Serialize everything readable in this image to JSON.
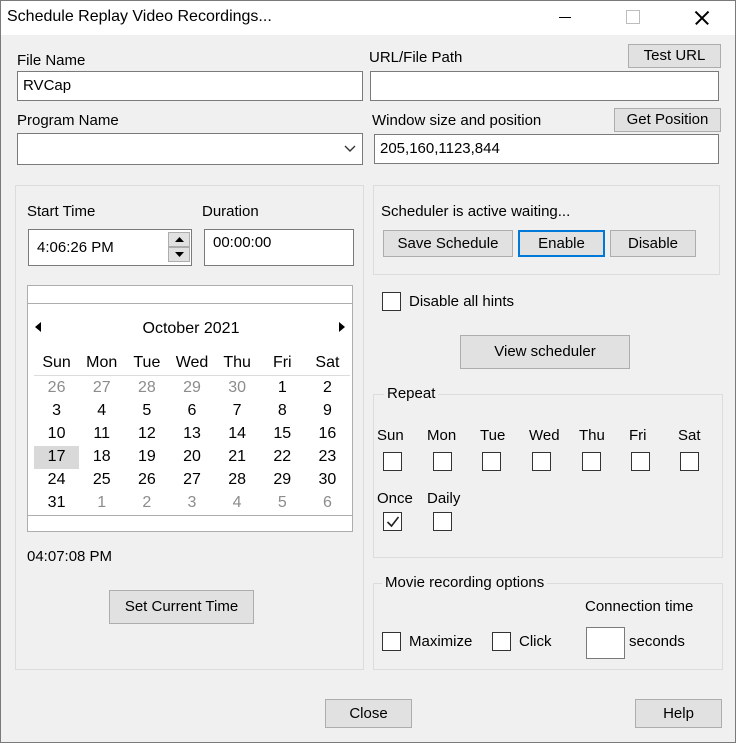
{
  "window": {
    "title": "Schedule Replay Video Recordings..."
  },
  "fields": {
    "file_name_label": "File Name",
    "file_name_value": "RVCap",
    "url_label": "URL/File Path",
    "url_value": "",
    "test_url_label": "Test URL",
    "program_name_label": "Program Name",
    "program_name_value": "",
    "window_label": "Window size and position",
    "window_value": "205,160,1123,844",
    "get_position_label": "Get Position"
  },
  "time": {
    "start_label": "Start Time",
    "start_value": "4:06:26 PM",
    "duration_label": "Duration",
    "duration_value": "00:00:00",
    "current_time": "04:07:08 PM",
    "set_current_label": "Set Current Time"
  },
  "calendar": {
    "month": "October 2021",
    "weekdays": [
      "Sun",
      "Mon",
      "Tue",
      "Wed",
      "Thu",
      "Fri",
      "Sat"
    ],
    "weeks": [
      [
        [
          "26",
          1
        ],
        [
          "27",
          1
        ],
        [
          "28",
          1
        ],
        [
          "29",
          1
        ],
        [
          "30",
          1
        ],
        [
          "1",
          0
        ],
        [
          "2",
          0
        ]
      ],
      [
        [
          "3",
          0
        ],
        [
          "4",
          0
        ],
        [
          "5",
          0
        ],
        [
          "6",
          0
        ],
        [
          "7",
          0
        ],
        [
          "8",
          0
        ],
        [
          "9",
          0
        ]
      ],
      [
        [
          "10",
          0
        ],
        [
          "11",
          0
        ],
        [
          "12",
          0
        ],
        [
          "13",
          0
        ],
        [
          "14",
          0
        ],
        [
          "15",
          0
        ],
        [
          "16",
          0
        ]
      ],
      [
        [
          "17",
          0
        ],
        [
          "18",
          0
        ],
        [
          "19",
          0
        ],
        [
          "20",
          0
        ],
        [
          "21",
          0
        ],
        [
          "22",
          0
        ],
        [
          "23",
          0
        ]
      ],
      [
        [
          "24",
          0
        ],
        [
          "25",
          0
        ],
        [
          "26",
          0
        ],
        [
          "27",
          0
        ],
        [
          "28",
          0
        ],
        [
          "29",
          0
        ],
        [
          "30",
          0
        ]
      ],
      [
        [
          "31",
          0
        ],
        [
          "1",
          1
        ],
        [
          "2",
          1
        ],
        [
          "3",
          1
        ],
        [
          "4",
          1
        ],
        [
          "5",
          1
        ],
        [
          "6",
          1
        ]
      ]
    ],
    "selected": "17"
  },
  "scheduler": {
    "status": "Scheduler is active waiting...",
    "save_label": "Save Schedule",
    "enable_label": "Enable",
    "disable_label": "Disable",
    "disable_hints_label": "Disable all hints",
    "view_label": "View scheduler"
  },
  "repeat": {
    "title": "Repeat",
    "days": [
      "Sun",
      "Mon",
      "Tue",
      "Wed",
      "Thu",
      "Fri",
      "Sat"
    ],
    "once_label": "Once",
    "once_checked": true,
    "daily_label": "Daily"
  },
  "movie": {
    "title": "Movie recording options",
    "connection_label": "Connection time",
    "maximize_label": "Maximize",
    "click_label": "Click",
    "seconds_label": "seconds",
    "connection_value": ""
  },
  "footer": {
    "close_label": "Close",
    "help_label": "Help"
  }
}
